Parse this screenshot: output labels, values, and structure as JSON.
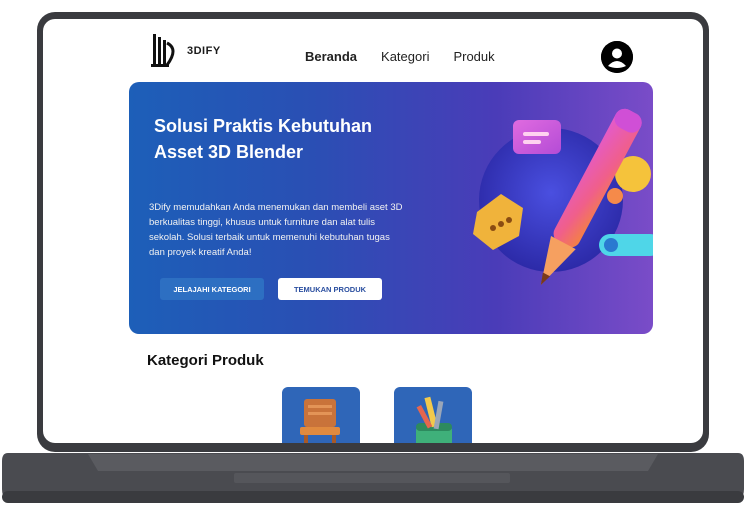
{
  "nav": {
    "brand": "3DIFY",
    "links": [
      "Beranda",
      "Kategori",
      "Produk"
    ],
    "active": "Beranda"
  },
  "hero": {
    "title": "Solusi Praktis Kebutuhan Asset 3D Blender",
    "description": "3Dify memudahkan Anda menemukan dan membeli aset 3D berkualitas tinggi, khusus untuk furniture dan alat tulis sekolah. Solusi terbaik untuk memenuhi kebutuhan tugas dan proyek kreatif Anda!",
    "primary_button": "JELAJAHI KATEGORI",
    "secondary_button": "TEMUKAN PRODUK"
  },
  "categories": {
    "title": "Kategori Produk",
    "items": [
      {
        "icon": "chair-icon"
      },
      {
        "icon": "pencil-case-icon"
      }
    ]
  },
  "colors": {
    "hero_start": "#1d5fb8",
    "hero_end": "#7a4cc8",
    "card": "#2f66b8",
    "primary_button": "#2d6fc2"
  }
}
